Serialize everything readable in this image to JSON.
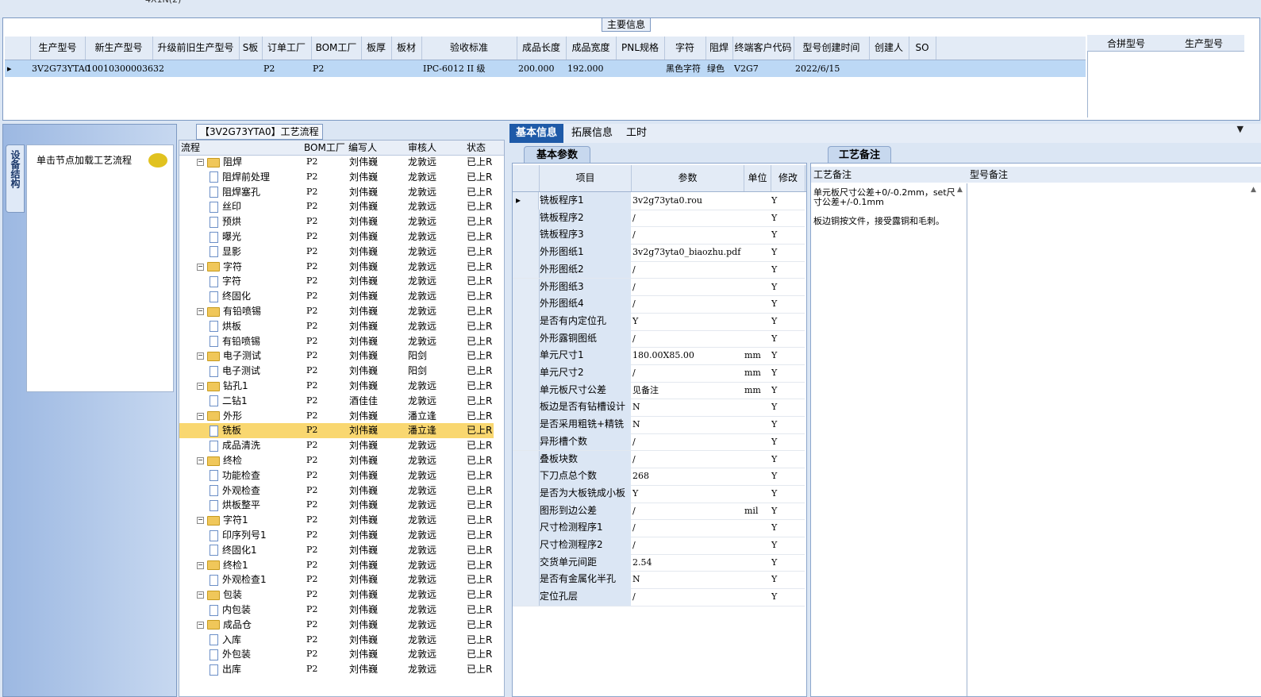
{
  "main_info": {
    "title": "主要信息",
    "columns": [
      "生产型号",
      "新生产型号",
      "升级前旧生产型号",
      "S板",
      "订单工厂",
      "BOM工厂",
      "板厚",
      "板材",
      "验收标准",
      "成品长度",
      "成品宽度",
      "PNL规格",
      "字符",
      "阻焊",
      "终端客户代码",
      "型号创建时间",
      "创建人",
      "SO"
    ],
    "row": [
      "3V2G73YTA0",
      "10010300003632",
      "",
      "",
      "P2",
      "P2",
      "",
      "",
      "IPC-6012 II 级",
      "200.000",
      "192.000",
      "",
      "黑色字符",
      "绿色",
      "V2G7",
      "2022/6/15",
      "",
      ""
    ],
    "merge_columns": [
      "合拼型号",
      "生产型号"
    ]
  },
  "left_dock": {
    "tab_label": "设备结构",
    "message": "单击节点加载工艺流程"
  },
  "flow": {
    "title": "【3V2G73YTA0】工艺流程",
    "columns": [
      "流程",
      "BOM工厂",
      "编写人",
      "审核人",
      "状态"
    ],
    "rows": [
      {
        "level": 0,
        "name": "阻焊",
        "bom": "P2",
        "writer": "刘伟巍",
        "reviewer": "龙敦远",
        "status": "已上R"
      },
      {
        "level": 1,
        "name": "阻焊前处理",
        "bom": "P2",
        "writer": "刘伟巍",
        "reviewer": "龙敦远",
        "status": "已上R"
      },
      {
        "level": 1,
        "name": "阻焊塞孔",
        "bom": "P2",
        "writer": "刘伟巍",
        "reviewer": "龙敦远",
        "status": "已上R"
      },
      {
        "level": 1,
        "name": "丝印",
        "bom": "P2",
        "writer": "刘伟巍",
        "reviewer": "龙敦远",
        "status": "已上R"
      },
      {
        "level": 1,
        "name": "预烘",
        "bom": "P2",
        "writer": "刘伟巍",
        "reviewer": "龙敦远",
        "status": "已上R"
      },
      {
        "level": 1,
        "name": "曝光",
        "bom": "P2",
        "writer": "刘伟巍",
        "reviewer": "龙敦远",
        "status": "已上R"
      },
      {
        "level": 1,
        "name": "显影",
        "bom": "P2",
        "writer": "刘伟巍",
        "reviewer": "龙敦远",
        "status": "已上R"
      },
      {
        "level": 0,
        "name": "字符",
        "bom": "P2",
        "writer": "刘伟巍",
        "reviewer": "龙敦远",
        "status": "已上R"
      },
      {
        "level": 1,
        "name": "字符",
        "bom": "P2",
        "writer": "刘伟巍",
        "reviewer": "龙敦远",
        "status": "已上R"
      },
      {
        "level": 1,
        "name": "终固化",
        "bom": "P2",
        "writer": "刘伟巍",
        "reviewer": "龙敦远",
        "status": "已上R"
      },
      {
        "level": 0,
        "name": "有铅喷锡",
        "bom": "P2",
        "writer": "刘伟巍",
        "reviewer": "龙敦远",
        "status": "已上R"
      },
      {
        "level": 1,
        "name": "烘板",
        "bom": "P2",
        "writer": "刘伟巍",
        "reviewer": "龙敦远",
        "status": "已上R"
      },
      {
        "level": 1,
        "name": "有铅喷锡",
        "bom": "P2",
        "writer": "刘伟巍",
        "reviewer": "龙敦远",
        "status": "已上R"
      },
      {
        "level": 0,
        "name": "电子测试",
        "bom": "P2",
        "writer": "刘伟巍",
        "reviewer": "阳剑",
        "status": "已上R"
      },
      {
        "level": 1,
        "name": "电子测试",
        "bom": "P2",
        "writer": "刘伟巍",
        "reviewer": "阳剑",
        "status": "已上R"
      },
      {
        "level": 0,
        "name": "钻孔1",
        "bom": "P2",
        "writer": "刘伟巍",
        "reviewer": "龙敦远",
        "status": "已上R"
      },
      {
        "level": 1,
        "name": "二钻1",
        "bom": "P2",
        "writer": "酒佳佳",
        "reviewer": "龙敦远",
        "status": "已上R"
      },
      {
        "level": 0,
        "name": "外形",
        "bom": "P2",
        "writer": "刘伟巍",
        "reviewer": "潘立逢",
        "status": "已上R"
      },
      {
        "level": 1,
        "name": "铣板",
        "bom": "P2",
        "writer": "刘伟巍",
        "reviewer": "潘立逢",
        "status": "已上R",
        "selected": true
      },
      {
        "level": 1,
        "name": "成品清洗",
        "bom": "P2",
        "writer": "刘伟巍",
        "reviewer": "龙敦远",
        "status": "已上R"
      },
      {
        "level": 0,
        "name": "终检",
        "bom": "P2",
        "writer": "刘伟巍",
        "reviewer": "龙敦远",
        "status": "已上R"
      },
      {
        "level": 1,
        "name": "功能检查",
        "bom": "P2",
        "writer": "刘伟巍",
        "reviewer": "龙敦远",
        "status": "已上R"
      },
      {
        "level": 1,
        "name": "外观检查",
        "bom": "P2",
        "writer": "刘伟巍",
        "reviewer": "龙敦远",
        "status": "已上R"
      },
      {
        "level": 1,
        "name": "烘板整平",
        "bom": "P2",
        "writer": "刘伟巍",
        "reviewer": "龙敦远",
        "status": "已上R"
      },
      {
        "level": 0,
        "name": "字符1",
        "bom": "P2",
        "writer": "刘伟巍",
        "reviewer": "龙敦远",
        "status": "已上R"
      },
      {
        "level": 1,
        "name": "印序列号1",
        "bom": "P2",
        "writer": "刘伟巍",
        "reviewer": "龙敦远",
        "status": "已上R"
      },
      {
        "level": 1,
        "name": "终固化1",
        "bom": "P2",
        "writer": "刘伟巍",
        "reviewer": "龙敦远",
        "status": "已上R"
      },
      {
        "level": 0,
        "name": "终检1",
        "bom": "P2",
        "writer": "刘伟巍",
        "reviewer": "龙敦远",
        "status": "已上R"
      },
      {
        "level": 1,
        "name": "外观检查1",
        "bom": "P2",
        "writer": "刘伟巍",
        "reviewer": "龙敦远",
        "status": "已上R"
      },
      {
        "level": 0,
        "name": "包装",
        "bom": "P2",
        "writer": "刘伟巍",
        "reviewer": "龙敦远",
        "status": "已上R"
      },
      {
        "level": 1,
        "name": "内包装",
        "bom": "P2",
        "writer": "刘伟巍",
        "reviewer": "龙敦远",
        "status": "已上R"
      },
      {
        "level": 0,
        "name": "成品仓",
        "bom": "P2",
        "writer": "刘伟巍",
        "reviewer": "龙敦远",
        "status": "已上R"
      },
      {
        "level": 1,
        "name": "入库",
        "bom": "P2",
        "writer": "刘伟巍",
        "reviewer": "龙敦远",
        "status": "已上R"
      },
      {
        "level": 1,
        "name": "外包装",
        "bom": "P2",
        "writer": "刘伟巍",
        "reviewer": "龙敦远",
        "status": "已上R"
      },
      {
        "level": 1,
        "name": "出库",
        "bom": "P2",
        "writer": "刘伟巍",
        "reviewer": "龙敦远",
        "status": "已上R"
      }
    ]
  },
  "tabs": [
    "基本信息",
    "拓展信息",
    "工时"
  ],
  "basic_params": {
    "title": "基本参数",
    "columns": [
      "项目",
      "参数",
      "单位",
      "修改"
    ],
    "rows": [
      {
        "item": "铣板程序1",
        "param": "3v2g73yta0.rou",
        "unit": "",
        "mod": "Y"
      },
      {
        "item": "铣板程序2",
        "param": "/",
        "unit": "",
        "mod": "Y"
      },
      {
        "item": "铣板程序3",
        "param": "/",
        "unit": "",
        "mod": "Y"
      },
      {
        "item": "外形图纸1",
        "param": "3v2g73yta0_biaozhu.pdf",
        "unit": "",
        "mod": "Y"
      },
      {
        "item": "外形图纸2",
        "param": "/",
        "unit": "",
        "mod": "Y"
      },
      {
        "item": "外形图纸3",
        "param": "/",
        "unit": "",
        "mod": "Y"
      },
      {
        "item": "外形图纸4",
        "param": "/",
        "unit": "",
        "mod": "Y"
      },
      {
        "item": "是否有内定位孔",
        "param": "Y",
        "unit": "",
        "mod": "Y"
      },
      {
        "item": "外形露铜图纸",
        "param": "/",
        "unit": "",
        "mod": "Y"
      },
      {
        "item": "单元尺寸1",
        "param": "180.00X85.00",
        "unit": "mm",
        "mod": "Y"
      },
      {
        "item": "单元尺寸2",
        "param": "/",
        "unit": "mm",
        "mod": "Y"
      },
      {
        "item": "单元板尺寸公差",
        "param": "见备注",
        "unit": "mm",
        "mod": "Y"
      },
      {
        "item": "板边是否有钻槽设计",
        "param": "N",
        "unit": "",
        "mod": "Y"
      },
      {
        "item": "是否采用粗铣+精铣",
        "param": "N",
        "unit": "",
        "mod": "Y"
      },
      {
        "item": "异形槽个数",
        "param": "/",
        "unit": "",
        "mod": "Y"
      },
      {
        "item": "叠板块数",
        "param": "/",
        "unit": "",
        "mod": "Y"
      },
      {
        "item": "下刀点总个数",
        "param": "268",
        "unit": "",
        "mod": "Y"
      },
      {
        "item": "是否为大板铣成小板",
        "param": "Y",
        "unit": "",
        "mod": "Y"
      },
      {
        "item": "图形到边公差",
        "param": "/",
        "unit": "mil",
        "mod": "Y"
      },
      {
        "item": "尺寸检测程序1",
        "param": "/",
        "unit": "",
        "mod": "Y"
      },
      {
        "item": "尺寸检测程序2",
        "param": "/",
        "unit": "",
        "mod": "Y"
      },
      {
        "item": "交货单元间距",
        "param": "2.54",
        "unit": "",
        "mod": "Y"
      },
      {
        "item": "是否有金属化半孔",
        "param": "N",
        "unit": "",
        "mod": "Y"
      },
      {
        "item": "定位孔层",
        "param": "/",
        "unit": "",
        "mod": "Y"
      }
    ]
  },
  "process_notes": {
    "title": "工艺备注",
    "col_process": "工艺备注",
    "col_model": "型号备注",
    "text": "单元板尺寸公差+0/-0.2mm，set尺寸公差+/-0.1mm\n\n板边铜按文件，接受露铜和毛刺。"
  }
}
